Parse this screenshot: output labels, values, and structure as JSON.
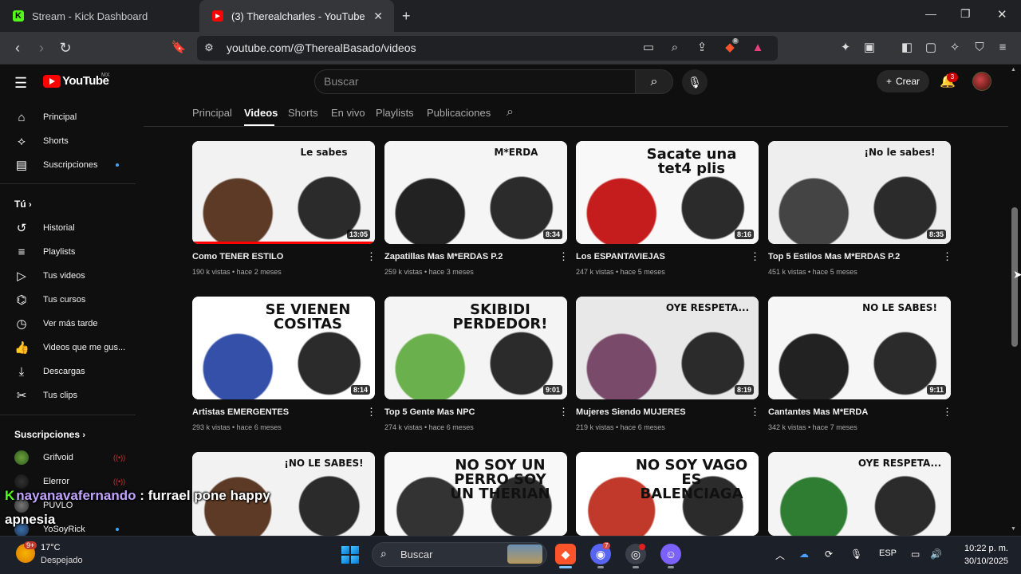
{
  "browser": {
    "tabs": [
      {
        "title": "Stream - Kick Dashboard",
        "favicon": "kick-icon",
        "color": "#53fc18"
      },
      {
        "title": "(3) Therealcharles - YouTube",
        "favicon": "youtube-icon",
        "color": "#ff0000"
      }
    ],
    "new_tab": "+",
    "url": "youtube.com/@TherealBasado/videos",
    "brave_badge": "8"
  },
  "youtube": {
    "logo_text": "YouTube",
    "region": "MX",
    "search_placeholder": "Buscar",
    "create_label": "Crear",
    "notifications_count": "3"
  },
  "sidebar": {
    "main": [
      {
        "label": "Principal",
        "icon": "home-icon"
      },
      {
        "label": "Shorts",
        "icon": "shorts-icon"
      },
      {
        "label": "Suscripciones",
        "icon": "subscriptions-icon"
      }
    ],
    "you_title": "Tú",
    "you": [
      {
        "label": "Historial",
        "icon": "history-icon"
      },
      {
        "label": "Playlists",
        "icon": "playlists-icon"
      },
      {
        "label": "Tus videos",
        "icon": "your-videos-icon"
      },
      {
        "label": "Tus cursos",
        "icon": "courses-icon"
      },
      {
        "label": "Ver más tarde",
        "icon": "watch-later-icon"
      },
      {
        "label": "Videos que me gus...",
        "icon": "like-icon"
      },
      {
        "label": "Descargas",
        "icon": "download-icon"
      },
      {
        "label": "Tus clips",
        "icon": "clips-icon"
      }
    ],
    "subs_title": "Suscripciones",
    "subs": [
      {
        "label": "Grifvoid"
      },
      {
        "label": "Elerror"
      },
      {
        "label": "PUVLO"
      },
      {
        "label": "YoSoyRick"
      }
    ]
  },
  "channel_tabs": [
    "Principal",
    "Videos",
    "Shorts",
    "En vivo",
    "Playlists",
    "Publicaciones"
  ],
  "videos": [
    {
      "title": "Como TENER ESTILO",
      "views": "190 k vistas",
      "age": "hace 2 meses",
      "duration": "13:05",
      "overlay": "Le sabes",
      "progress": 1.0
    },
    {
      "title": "Zapatillas Mas M*ERDAS P.2",
      "views": "259 k vistas",
      "age": "hace 3 meses",
      "duration": "8:34",
      "overlay": "M*ERDA"
    },
    {
      "title": "Los ESPANTAVIEJAS",
      "views": "247 k vistas",
      "age": "hace 5 meses",
      "duration": "8:16",
      "overlay": "Sacate una tet4 plis"
    },
    {
      "title": "Top 5 Estilos Mas M*ERDAS P.2",
      "views": "451 k vistas",
      "age": "hace 5 meses",
      "duration": "8:35",
      "overlay": "¡No le sabes!"
    },
    {
      "title": "Artistas EMERGENTES",
      "views": "293 k vistas",
      "age": "hace 6 meses",
      "duration": "8:14",
      "overlay": "SE VIENEN COSITAS"
    },
    {
      "title": "Top 5 Gente Mas NPC",
      "views": "274 k vistas",
      "age": "hace 6 meses",
      "duration": "9:01",
      "overlay": "SKIBIDI PERDEDOR!"
    },
    {
      "title": "Mujeres Siendo MUJERES",
      "views": "219 k vistas",
      "age": "hace 6 meses",
      "duration": "8:19",
      "overlay": "OYE RESPETA..."
    },
    {
      "title": "Cantantes Mas M*ERDA",
      "views": "342 k vistas",
      "age": "hace 7 meses",
      "duration": "9:11",
      "overlay": "NO LE SABES!"
    },
    {
      "title": "",
      "views": "",
      "age": "",
      "duration": "",
      "overlay": "¡NO LE SABES!"
    },
    {
      "title": "",
      "views": "",
      "age": "",
      "duration": "",
      "overlay": "NO SOY UN PERRO SOY UN THERIAN"
    },
    {
      "title": "",
      "views": "",
      "age": "",
      "duration": "",
      "overlay": "NO SOY VAGO ES BALENCIAGA"
    },
    {
      "title": "",
      "views": "",
      "age": "",
      "duration": "",
      "overlay": "OYE RESPETA..."
    }
  ],
  "chat": {
    "user": "nayanavafernando",
    "message": ": furrael pone happy",
    "continuation": "apnesia"
  },
  "taskbar": {
    "weather_badge": "9+",
    "temperature": "17°C",
    "condition": "Despejado",
    "search": "Buscar",
    "discord_badge": "7",
    "language": "ESP",
    "time": "10:22 p. m.",
    "date": "30/10/2025"
  },
  "colors": {
    "accent": "#ff0000",
    "kick": "#53fc18",
    "link_blue": "#3ea6ff"
  }
}
